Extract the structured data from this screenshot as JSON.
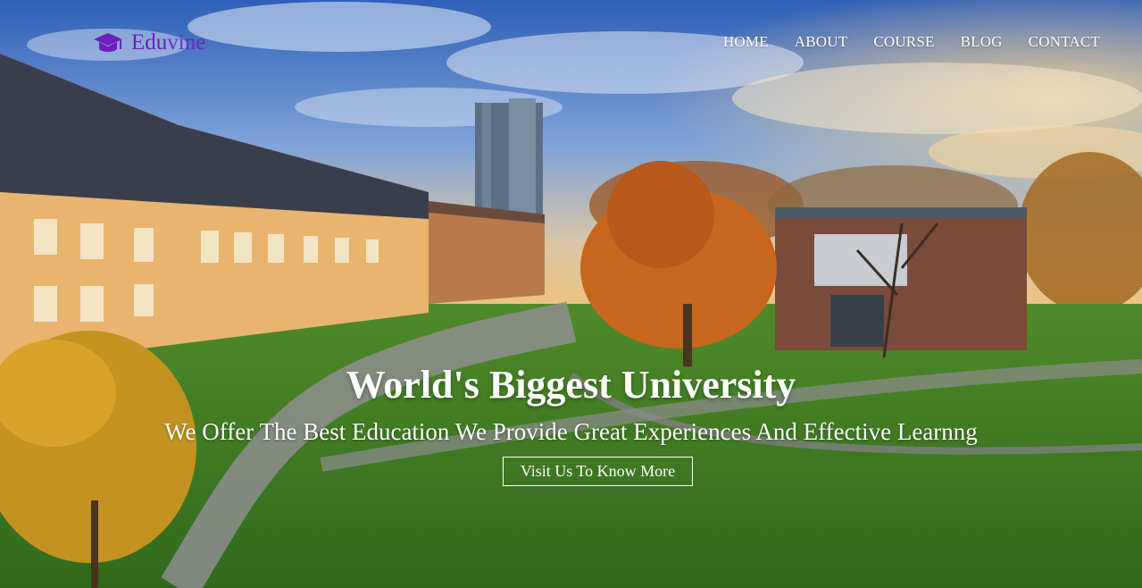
{
  "brand": {
    "part1": "Edu",
    "part2": "vine",
    "icon": "graduation-cap-icon",
    "color": "#6b1fbd"
  },
  "nav": {
    "items": [
      {
        "label": "HOME"
      },
      {
        "label": "ABOUT"
      },
      {
        "label": "COURSE"
      },
      {
        "label": "BLOG"
      },
      {
        "label": "CONTACT"
      }
    ]
  },
  "hero": {
    "title": "World's Biggest University",
    "subtitle": "We Offer The Best Education We Provide Great Experiences And Effective Learnng",
    "cta_label": "Visit Us To Know More",
    "background": "campus-photo"
  }
}
